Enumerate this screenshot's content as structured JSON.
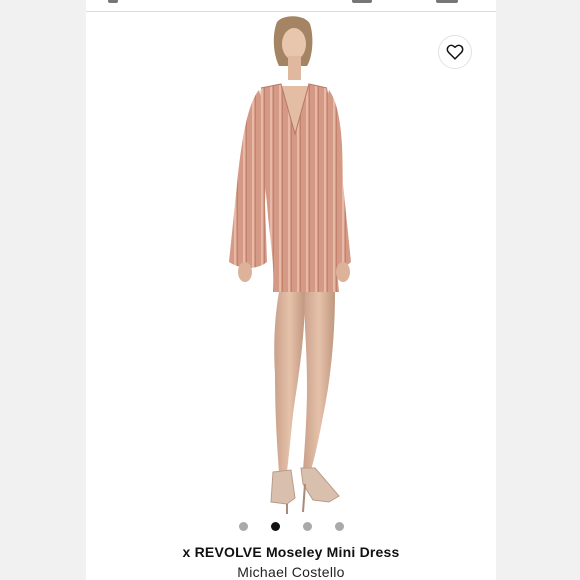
{
  "product": {
    "name": "x REVOLVE Moseley Mini Dress",
    "brand": "Michael Costello"
  },
  "gallery": {
    "image_count": 4,
    "active_index": 1
  },
  "icons": {
    "wishlist": "heart-icon"
  },
  "colors": {
    "dress": "#d49a85",
    "background": "#ffffff",
    "dot_active": "#111111",
    "dot_inactive": "#a9a9a9"
  }
}
